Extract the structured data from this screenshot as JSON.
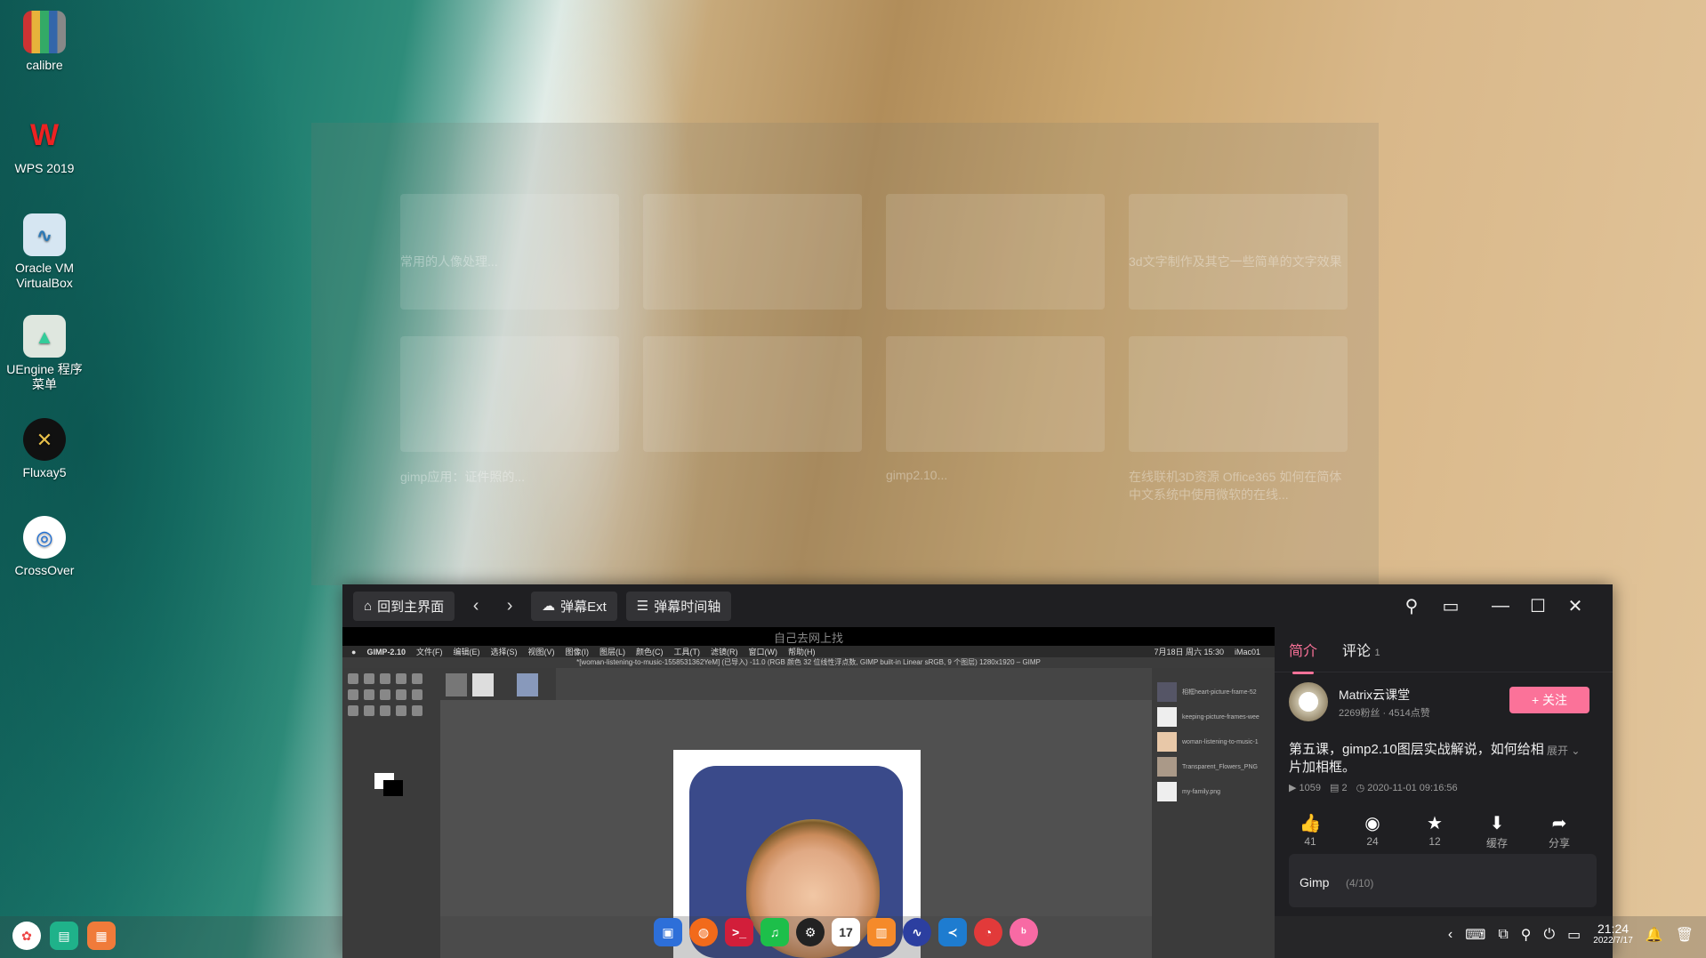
{
  "desktop": {
    "icons": [
      {
        "label": "calibre",
        "icon": "calibre-books-icon"
      },
      {
        "label": "WPS 2019",
        "icon": "wps-icon"
      },
      {
        "label": "Oracle VM VirtualBox",
        "icon": "virtualbox-icon"
      },
      {
        "label": "UEngine 程序菜单",
        "icon": "android-icon"
      },
      {
        "label": "Fluxay5",
        "icon": "fluxay-icon"
      },
      {
        "label": "CrossOver",
        "icon": "crossover-icon"
      }
    ]
  },
  "ghost_app": {
    "cards": [
      {
        "title": "常用的人像处理..."
      },
      {
        "title": ""
      },
      {
        "title": ""
      },
      {
        "title": "3d文字制作及其它一些简单的文字效果"
      },
      {
        "title": "gimp应用：证件照的..."
      },
      {
        "title": ""
      },
      {
        "title": "gimp2.10..."
      },
      {
        "title": "在线联机3D资源 Office365 如何在简体中文系统中使用微软的在线..."
      }
    ]
  },
  "window": {
    "toolbar": {
      "home_label": "回到主界面",
      "danmaku_ext_label": "弹幕Ext",
      "danmaku_timeline_label": "弹幕时间轴"
    },
    "video": {
      "caption": "自己去网上找",
      "mac_menu": [
        "GIMP-2.10",
        "文件(F)",
        "编辑(E)",
        "选择(S)",
        "视图(V)",
        "图像(I)",
        "图层(L)",
        "颜色(C)",
        "工具(T)",
        "滤镜(R)",
        "窗口(W)",
        "帮助(H)"
      ],
      "mac_status": "7月18日 周六 15:30",
      "mac_host": "iMac01",
      "gimp_title": "*[woman-listening-to-music-1558531362YeM] (已导入) -11.0 (RGB 颜色 32 位线性浮点数, GIMP built-in Linear sRGB, 9 个图层) 1280x1920 – GIMP",
      "layers": [
        "相框heart-picture-frame-52",
        "keeping-picture-frames-wee",
        "woman-listening-to-music-1",
        "Transparent_Flowers_PNG",
        "my-family.png"
      ]
    },
    "panel": {
      "tabs": [
        {
          "label": "简介"
        },
        {
          "label": "评论",
          "count": "1"
        }
      ],
      "uploader": {
        "name": "Matrix云课堂",
        "stats": "2269粉丝 · 4514点赞"
      },
      "follow_label": "+ 关注",
      "title": "第五课，gimp2.10图层实战解说，如何给相片加相框。",
      "expand_label": "展开",
      "meta": {
        "views": "1059",
        "danmaku": "2",
        "date": "2020-11-01 09:16:56"
      },
      "actions": [
        {
          "icon": "like-icon",
          "label": "41"
        },
        {
          "icon": "coin-icon",
          "label": "24"
        },
        {
          "icon": "star-icon",
          "label": "12"
        },
        {
          "icon": "download-icon",
          "label": "缓存"
        },
        {
          "icon": "share-icon",
          "label": "分享"
        }
      ],
      "playlist": {
        "name": "Gimp",
        "progress": "(4/10)"
      }
    }
  },
  "taskbar": {
    "clock": {
      "time": "21:24",
      "date": "2022/7/17"
    }
  }
}
